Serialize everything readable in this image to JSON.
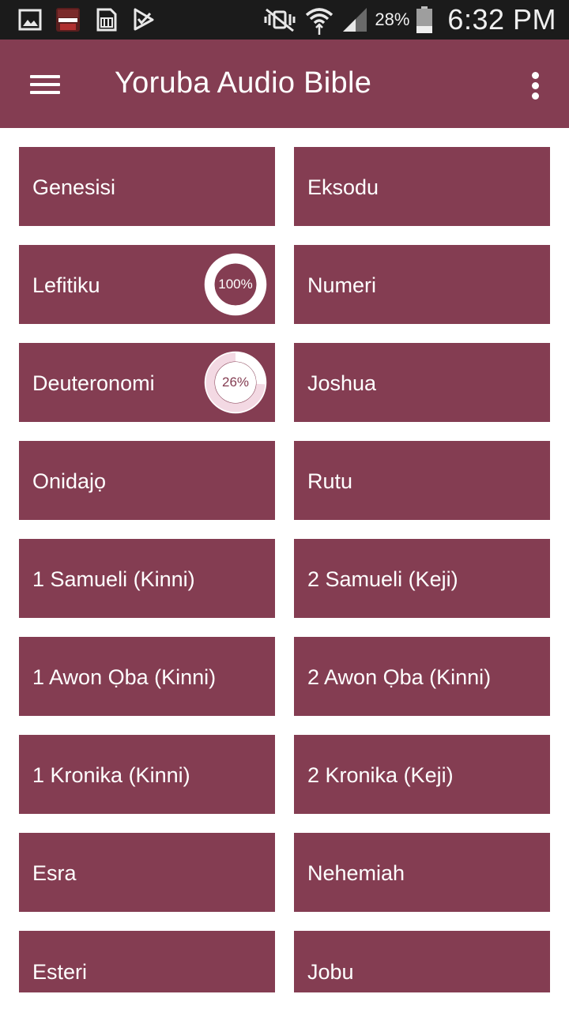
{
  "status_bar": {
    "left_icons": [
      "gallery-icon",
      "yoruba-app-icon",
      "sim-card-icon",
      "checkmark-download-icon"
    ],
    "right_icons": [
      "mute-vibrate-icon",
      "wifi-icon",
      "signal-icon",
      "battery-icon"
    ],
    "battery": "28%",
    "time": "6:32 PM"
  },
  "app_bar": {
    "title": "Yoruba Audio Bible",
    "background": "#843d52"
  },
  "books": [
    {
      "label": "Genesisi"
    },
    {
      "label": "Eksodu"
    },
    {
      "label": "Lefitiku",
      "progress": 100,
      "progress_label": "100%"
    },
    {
      "label": "Numeri"
    },
    {
      "label": "Deuteronomi",
      "progress": 26,
      "progress_label": "26%"
    },
    {
      "label": "Joshua"
    },
    {
      "label": "Onidajọ"
    },
    {
      "label": "Rutu"
    },
    {
      "label": "1 Samueli (Kinni)"
    },
    {
      "label": "2 Samueli (Keji)"
    },
    {
      "label": "1 Awon Ọba (Kinni)"
    },
    {
      "label": "2 Awon Ọba (Kinni)"
    },
    {
      "label": "1 Kronika (Kinni)"
    },
    {
      "label": "2 Kronika (Keji)"
    },
    {
      "label": "Esra"
    },
    {
      "label": "Nehemiah"
    },
    {
      "label": "Esteri"
    },
    {
      "label": "Jobu"
    }
  ]
}
